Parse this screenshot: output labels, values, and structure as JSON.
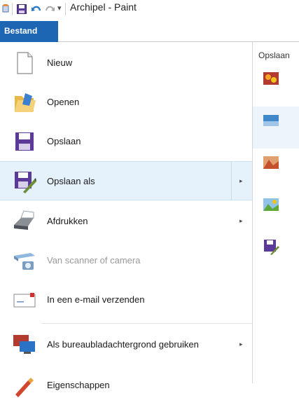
{
  "window": {
    "title": "Archipel - Paint"
  },
  "quick_access": {
    "app_icon": "paint-app-icon",
    "save_icon": "save-icon",
    "undo_icon": "undo-icon",
    "redo_icon": "redo-icon",
    "dropdown_glyph": "▾"
  },
  "file_tab": {
    "label": "Bestand"
  },
  "menu": {
    "items": [
      {
        "label": "Nieuw",
        "icon": "new-document-icon",
        "has_submenu": false,
        "enabled": true
      },
      {
        "label": "Openen",
        "icon": "open-folder-icon",
        "has_submenu": false,
        "enabled": true
      },
      {
        "label": "Opslaan",
        "icon": "save-disk-icon",
        "has_submenu": false,
        "enabled": true
      },
      {
        "label": "Opslaan als",
        "icon": "save-as-icon",
        "has_submenu": true,
        "enabled": true,
        "active": true
      },
      {
        "label": "Afdrukken",
        "icon": "printer-icon",
        "has_submenu": true,
        "enabled": true
      },
      {
        "label": "Van scanner of camera",
        "icon": "scanner-icon",
        "has_submenu": false,
        "enabled": false
      },
      {
        "label": "In een e-mail verzenden",
        "icon": "email-icon",
        "has_submenu": false,
        "enabled": true
      },
      {
        "label": "Als bureaubladachtergrond gebruiken",
        "icon": "desktop-background-icon",
        "has_submenu": true,
        "enabled": true
      },
      {
        "label": "Eigenschappen",
        "icon": "properties-icon",
        "has_submenu": false,
        "enabled": true
      }
    ],
    "submenu_arrow": "▸"
  },
  "recent": {
    "header": "Opslaan",
    "items": [
      {
        "icon": "png-image-icon"
      },
      {
        "icon": "jpeg-image-icon",
        "selected": true
      },
      {
        "icon": "bmp-image-icon"
      },
      {
        "icon": "gif-image-icon"
      },
      {
        "icon": "other-format-icon"
      }
    ]
  },
  "colors": {
    "file_tab": "#1d66b4",
    "active_row": "#e5f1fb",
    "disabled_text": "#9a9a9a"
  }
}
